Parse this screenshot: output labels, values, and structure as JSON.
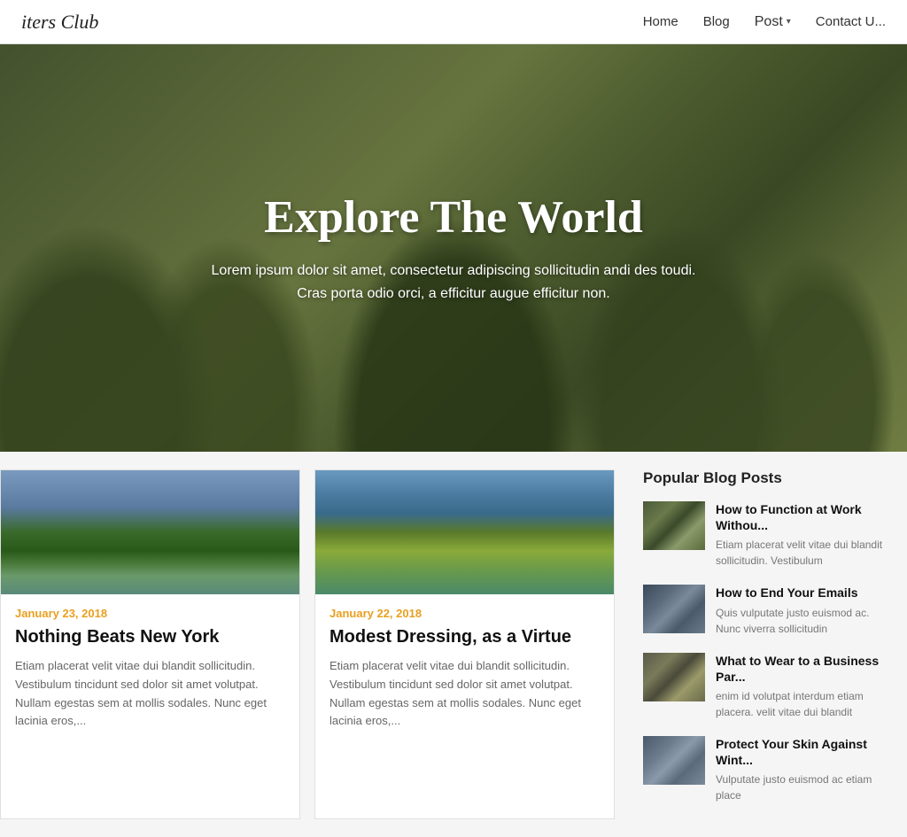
{
  "header": {
    "logo": "iters Club",
    "nav": {
      "home": "Home",
      "blog": "Blog",
      "post": "Post",
      "contact": "Contact U..."
    }
  },
  "hero": {
    "title": "Explore The World",
    "subtitle_line1": "Lorem ipsum dolor sit amet, consectetur adipiscing sollicitudin andi des toudi.",
    "subtitle_line2": "Cras porta odio orci, a efficitur augue efficitur non."
  },
  "posts": [
    {
      "date": "January 23, 2018",
      "title": "Nothing Beats New York",
      "excerpt": "Etiam placerat velit vitae dui blandit sollicitudin. Vestibulum tincidunt sed dolor sit amet volutpat. Nullam egestas sem at mollis sodales. Nunc eget lacinia eros,..."
    },
    {
      "date": "January 22, 2018",
      "title": "Modest Dressing, as a Virtue",
      "excerpt": "Etiam placerat velit vitae dui blandit sollicitudin. Vestibulum tincidunt sed dolor sit amet volutpat. Nullam egestas sem at mollis sodales. Nunc eget lacinia eros,..."
    }
  ],
  "sidebar": {
    "section_title": "Popular Blog Posts",
    "popular_posts": [
      {
        "title": "How to Function at Work Withou...",
        "excerpt": "Etiam placerat velit vitae dui blandit sollicitudin. Vestibulum"
      },
      {
        "title": "How to End Your Emails",
        "excerpt": "Quis vulputate justo euismod ac. Nunc viverra sollicitudin"
      },
      {
        "title": "What to Wear to a Business Par...",
        "excerpt": "enim id volutpat interdum etiam placera. velit vitae dui blandit"
      },
      {
        "title": "Protect Your Skin Against Wint...",
        "excerpt": "Vulputate justo euismod ac etiam place"
      }
    ]
  }
}
